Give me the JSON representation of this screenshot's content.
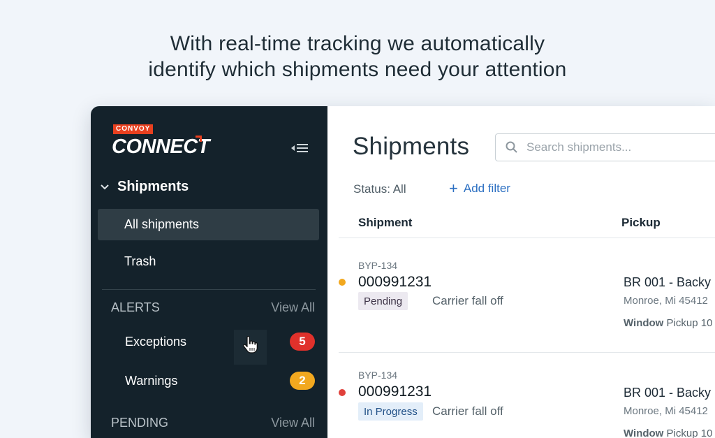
{
  "headline": {
    "line1": "With real-time tracking we automatically",
    "line2": "identify which shipments need your attention"
  },
  "sidebar": {
    "brand_badge": "CONVOY",
    "brand_name": "CONNECT",
    "section_title": "Shipments",
    "items": [
      {
        "label": "All shipments",
        "active": true
      },
      {
        "label": "Trash",
        "active": false
      }
    ],
    "alerts": {
      "title": "ALERTS",
      "view_all": "View All",
      "rows": [
        {
          "label": "Exceptions",
          "count": "5",
          "color": "#e0312b"
        },
        {
          "label": "Warnings",
          "count": "2",
          "color": "#f2a81f"
        }
      ]
    },
    "pending": {
      "title": "PENDING",
      "view_all": "View All"
    }
  },
  "main": {
    "title": "Shipments",
    "search_placeholder": "Search shipments...",
    "status_filter": "Status: All",
    "add_filter": "Add filter",
    "columns": [
      "Shipment",
      "Pickup"
    ],
    "rows": [
      {
        "ship_id": "BYP-134",
        "ship_num": "000991231",
        "status": "Pending",
        "status_bg": "#ece9f0",
        "status_color": "#3d3346",
        "dot_color": "#f2a81f",
        "reason": "Carrier fall off",
        "pickup_name": "BR 001 - Backy",
        "pickup_loc": "Monroe, Mi 45412",
        "pickup_window_label": "Window",
        "pickup_window": "Pickup 10"
      },
      {
        "ship_id": "BYP-134",
        "ship_num": "000991231",
        "status": "In Progress",
        "status_bg": "#e3eef9",
        "status_color": "#1f4f86",
        "dot_color": "#e0413b",
        "reason": "Carrier fall off",
        "pickup_name": "BR 001 - Backy",
        "pickup_loc": "Monroe, Mi 45412",
        "pickup_window_label": "Window",
        "pickup_window": "Pickup 10"
      }
    ]
  }
}
